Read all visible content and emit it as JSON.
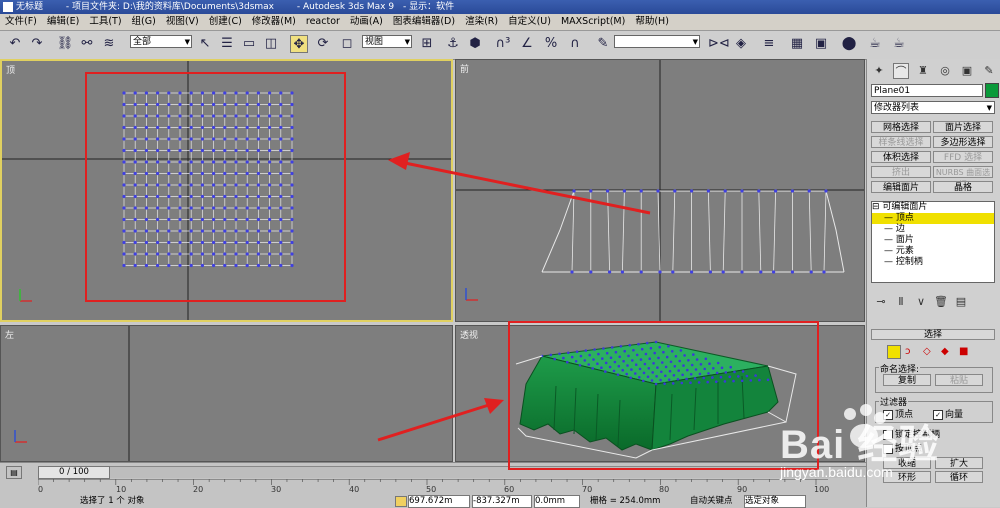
{
  "title": {
    "app_name": "无标题",
    "project": "- 项目文件夹: D:\\我的资料库\\Documents\\3dsmax",
    "product": "- Autodesk 3ds Max 9",
    "display": "- 显示：软件"
  },
  "menu": [
    "文件(F)",
    "编辑(E)",
    "工具(T)",
    "组(G)",
    "视图(V)",
    "创建(C)",
    "修改器(M)",
    "reactor",
    "动画(A)",
    "图表编辑器(D)",
    "渲染(R)",
    "自定义(U)",
    "MAXScript(M)",
    "帮助(H)"
  ],
  "toolbar": {
    "selection_filter": "全部",
    "reference_coord": "视图",
    "named_selection": ""
  },
  "viewports": {
    "top": "顶",
    "front": "前",
    "left": "左",
    "perspective": "透视"
  },
  "command_panel": {
    "object_name": "Plane01",
    "object_color": "#0a9a3a",
    "modifier_list": "修改器列表",
    "buttons": [
      {
        "label": "网格选择",
        "enabled": true
      },
      {
        "label": "面片选择",
        "enabled": true
      },
      {
        "label": "样条线选择",
        "enabled": false
      },
      {
        "label": "多边形选择",
        "enabled": true
      },
      {
        "label": "体积选择",
        "enabled": true
      },
      {
        "label": "FFD 选择",
        "enabled": false
      },
      {
        "label": "挤出",
        "enabled": false
      },
      {
        "label": "NURBS 曲面选择",
        "enabled": false
      },
      {
        "label": "编辑面片",
        "enabled": true
      },
      {
        "label": "晶格",
        "enabled": true
      }
    ],
    "stack": {
      "root": "可编辑面片",
      "items": [
        "顶点",
        "边",
        "面片",
        "元素",
        "控制柄"
      ],
      "selected": "顶点"
    },
    "selection": {
      "header": "选择",
      "named_sel_title": "命名选择:",
      "copy": "复制",
      "paste": "粘贴",
      "filter_title": "过滤器",
      "filter_vertex": "顶点",
      "filter_vector": "向量",
      "lock_handles": "锁定控制柄",
      "by_vertex": "按顶点",
      "shrink": "收缩",
      "grow": "扩大",
      "ring": "环形",
      "loop": "循环"
    }
  },
  "timeline": {
    "frame": "0 / 100",
    "ticks": [
      "0",
      "10",
      "20",
      "30",
      "40",
      "50",
      "60",
      "70",
      "80",
      "90",
      "100"
    ]
  },
  "status": {
    "selected": "选择了 1 个 对象",
    "x_value": "697.672m",
    "y_value": "-837.327m",
    "z_value": "0.0mm",
    "grid": "栅格 = 254.0mm",
    "autokey": "自动关键点",
    "selected_object": "选定对象"
  },
  "watermark": {
    "brand": "Bai 经验",
    "url": "jingyan.baidu.com"
  }
}
